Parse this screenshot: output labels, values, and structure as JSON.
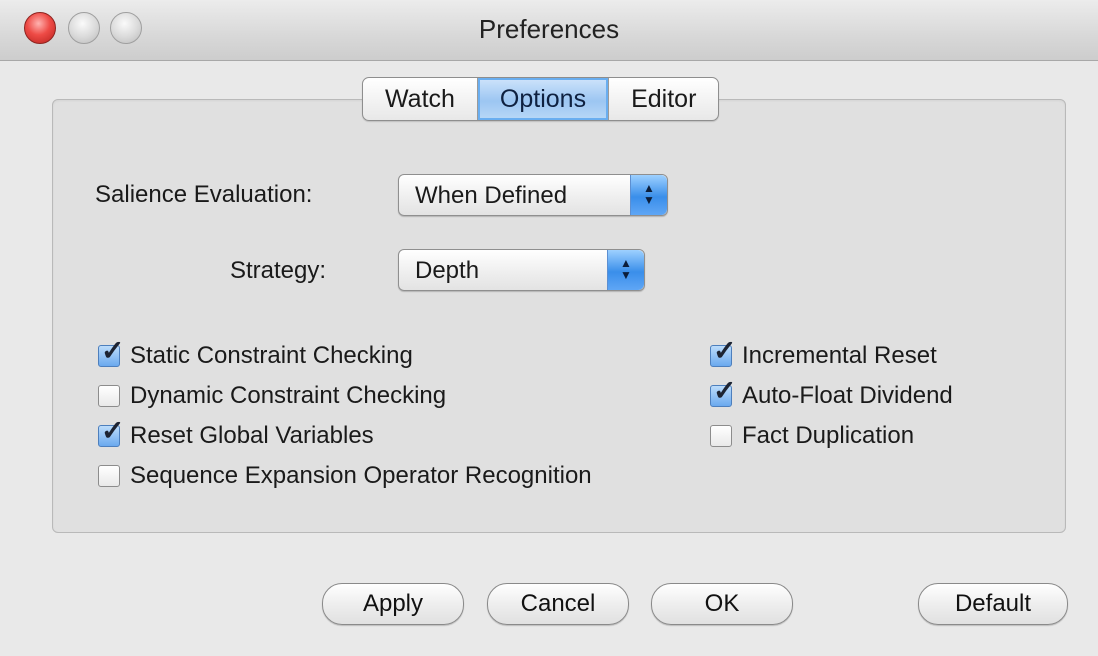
{
  "window": {
    "title": "Preferences"
  },
  "tabs": [
    {
      "label": "Watch",
      "active": false
    },
    {
      "label": "Options",
      "active": true
    },
    {
      "label": "Editor",
      "active": false
    }
  ],
  "fields": {
    "salience_label": "Salience Evaluation:",
    "salience_value": "When Defined",
    "strategy_label": "Strategy:",
    "strategy_value": "Depth"
  },
  "checkboxes_left": [
    {
      "label": "Static Constraint Checking",
      "checked": true
    },
    {
      "label": "Dynamic Constraint Checking",
      "checked": false
    },
    {
      "label": "Reset Global Variables",
      "checked": true
    },
    {
      "label": "Sequence Expansion Operator Recognition",
      "checked": false
    }
  ],
  "checkboxes_right": [
    {
      "label": "Incremental Reset",
      "checked": true
    },
    {
      "label": "Auto-Float Dividend",
      "checked": true
    },
    {
      "label": "Fact Duplication",
      "checked": false
    }
  ],
  "buttons": {
    "apply": "Apply",
    "cancel": "Cancel",
    "ok": "OK",
    "default": "Default"
  },
  "icons": {
    "checkmark": "check-icon",
    "popup_arrows": "up-down-arrows-icon"
  }
}
